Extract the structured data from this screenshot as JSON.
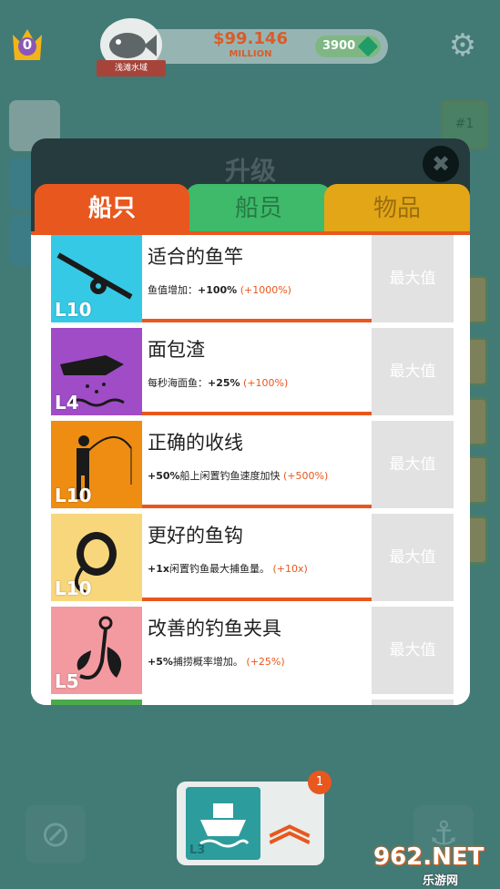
{
  "hud": {
    "crown_value": "0",
    "location": "浅滩水域",
    "money": "$99.146",
    "money_unit": "MILLION",
    "gems": "3900",
    "rank_badge": "#1"
  },
  "modal": {
    "title": "升级",
    "close": "✖",
    "tabs": [
      {
        "label": "船只"
      },
      {
        "label": "船员"
      },
      {
        "label": "物品"
      }
    ],
    "items": [
      {
        "name": "适合的鱼竿",
        "level": "L10",
        "desc_prefix": "鱼值增加：",
        "desc_value": "+100%",
        "desc_suffix": "",
        "bonus": "(+1000%)",
        "button": "最大值",
        "color": "#36c9e6"
      },
      {
        "name": "面包渣",
        "level": "L4",
        "desc_prefix": "每秒海面鱼：",
        "desc_value": "+25%",
        "desc_suffix": "",
        "bonus": "(+100%)",
        "button": "最大值",
        "color": "#a04cc7"
      },
      {
        "name": "正确的收线",
        "level": "L10",
        "desc_prefix": "",
        "desc_value": "+50%",
        "desc_suffix": "船上闲置钓鱼速度加快",
        "bonus": "(+500%)",
        "button": "最大值",
        "color": "#ee8d12"
      },
      {
        "name": "更好的鱼钩",
        "level": "L10",
        "desc_prefix": "",
        "desc_value": "+1x",
        "desc_suffix": "闲置钓鱼最大捕鱼量。",
        "bonus": "(+10x)",
        "button": "最大值",
        "color": "#f8d77c"
      },
      {
        "name": "改善的钓鱼夹具",
        "level": "L5",
        "desc_prefix": "",
        "desc_value": "+5%",
        "desc_suffix": "捕捞概率增加。",
        "bonus": "(+25%)",
        "button": "最大值",
        "color": "#f39aa0"
      }
    ]
  },
  "bottom": {
    "boat_level": "L3",
    "notification_count": "1"
  },
  "watermark": {
    "main": "962.NET",
    "sub": "乐游网"
  }
}
